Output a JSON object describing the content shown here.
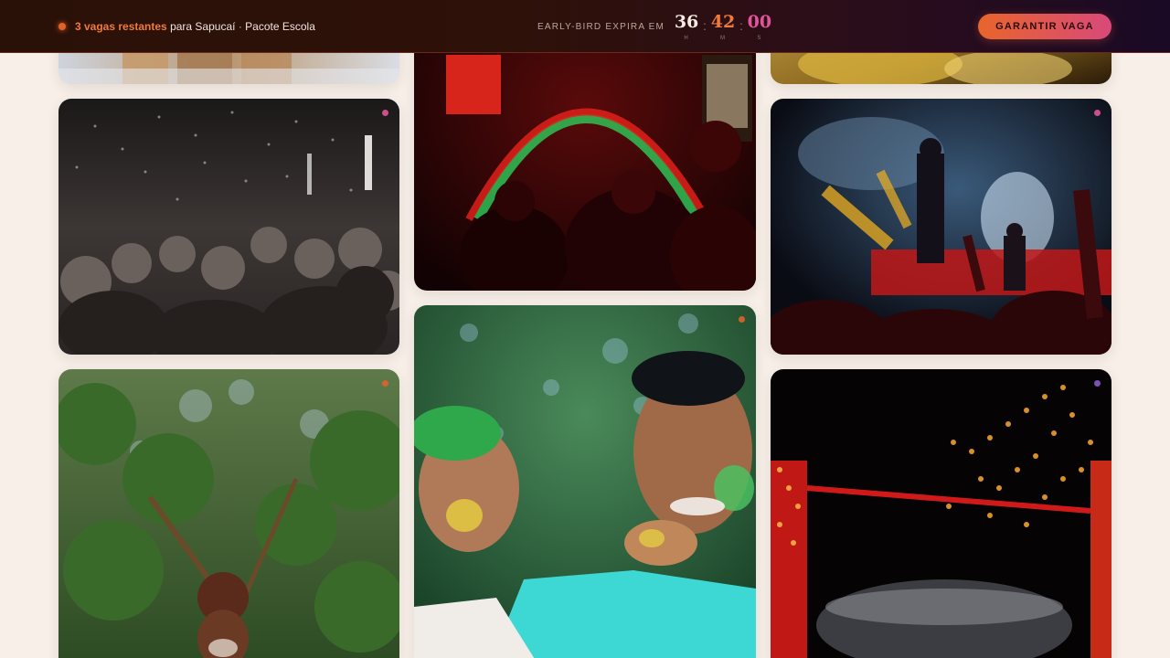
{
  "promo": {
    "highlight": "3 vagas restantes",
    "destination": "para Sapucaí",
    "separator": "·",
    "package": "Pacote Escola"
  },
  "countdown": {
    "label": "EARLY-BIRD EXPIRA EM",
    "hours": "36",
    "minutes": "42",
    "seconds": "00",
    "hours_unit": "H",
    "minutes_unit": "M",
    "seconds_unit": "S",
    "colon": ":"
  },
  "cta": {
    "label": "GARANTIR VAGA"
  },
  "colors": {
    "accent_orange": "#e8652b",
    "accent_pink": "#d9497a",
    "background": "#f7efe8"
  },
  "gallery": {
    "photos": [
      {
        "name": "photo-festival-dancers",
        "dot_color": "#e0559a"
      },
      {
        "name": "photo-neon-arch-crowd",
        "dot_color": "#e0559a"
      },
      {
        "name": "photo-gold-costume",
        "dot_color": "#e0622a"
      },
      {
        "name": "photo-bw-party-confetti",
        "dot_color": "#e0559a"
      },
      {
        "name": "photo-concert-stage",
        "dot_color": "#e0559a"
      },
      {
        "name": "photo-holi-colors",
        "dot_color": "#e0622a"
      },
      {
        "name": "photo-forest-portrait",
        "dot_color": "#e0622a"
      },
      {
        "name": "photo-night-lights",
        "dot_color": "#8a5ad0"
      }
    ]
  }
}
